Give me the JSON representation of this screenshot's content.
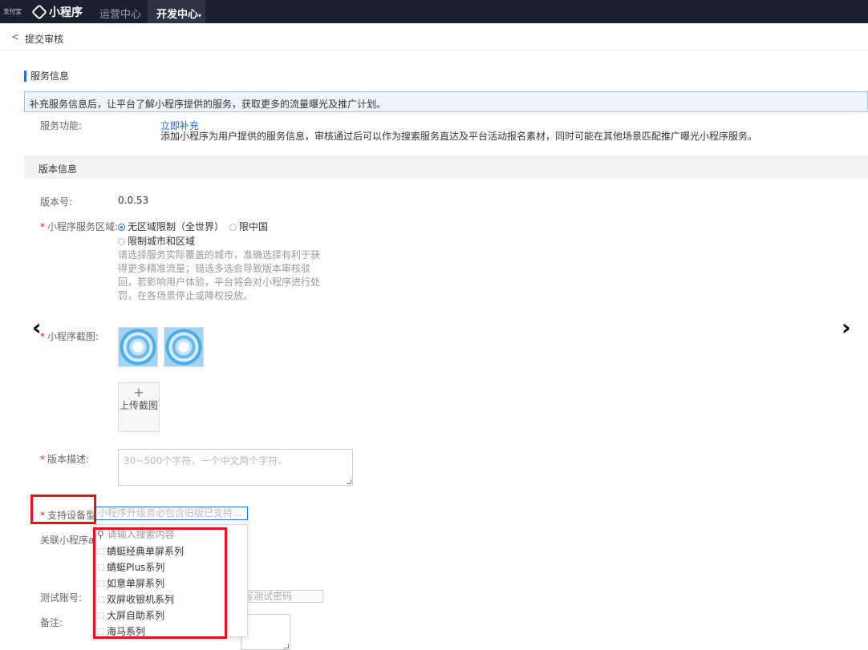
{
  "topbar": {
    "logo_small": "支付宝",
    "app_title": "小程序",
    "nav_items": [
      "运营中心",
      "开发中心"
    ],
    "active_nav_suffix": "▾"
  },
  "header": {
    "back_label": "提交审核"
  },
  "service": {
    "section_title": "服务信息",
    "notice": "补充服务信息后，让平台了解小程序提供的服务，获取更多的流量曝光及推广计划。",
    "function_label": "服务功能:",
    "function_link": "立即补充",
    "function_desc": "添加小程序为用户提供的服务信息，审核通过后可以作为搜索服务直达及平台活动报名素材，同时可能在其他场景匹配推广曝光小程序服务。"
  },
  "version": {
    "bar_title": "版本信息",
    "version_label": "版本号:",
    "version_value": "0.0.53",
    "region_label": "小程序服务区域:",
    "region_options": [
      "无区域限制（全世界）",
      "限中国",
      "限制城市和区域"
    ],
    "region_selected": 0,
    "region_hint": "请选择服务实际覆盖的城市，准确选择有利于获得更多精准流量；错选多选会导致版本审核驳回，若影响用户体验，平台将会对小程序进行处罚，在各场景停止或降权投放。",
    "screenshot_label": "小程序截图:",
    "upload_plus": "+",
    "upload_label": "上传截图",
    "desc_label": "版本描述:",
    "desc_placeholder": "30~500个字符，一个中文两个字符。",
    "device_label": "支持设备型",
    "device_placeholder": "小程序升级务必包含旧版已支持...",
    "related_label": "关联小程序a",
    "test_account_label": "测试账号:",
    "test_password_placeholder": "写测试密码",
    "remark_label": "备注:"
  },
  "dropdown": {
    "search_placeholder": "请输入搜索内容",
    "items": [
      "蜻蜓经典单屏系列",
      "蜻蜓Plus系列",
      "如意单屏系列",
      "双屏收银机系列",
      "大屏自助系列",
      "海马系列"
    ]
  },
  "nav_arrows": {
    "left": "‹",
    "right": "›"
  },
  "colors": {
    "accent": "#1a6fe8",
    "highlight": "#e8101a",
    "topbar": "#1b1f2e"
  }
}
